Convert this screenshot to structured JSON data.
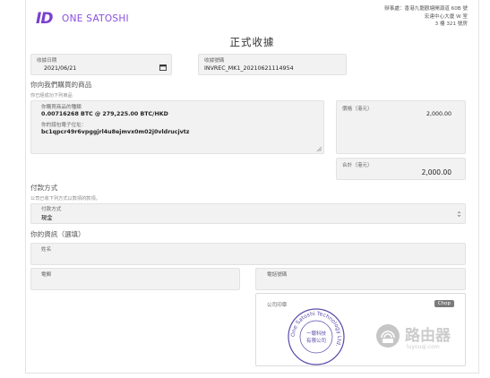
{
  "header": {
    "logo_mark": "ID",
    "logo_text": "ONE SATOSHI",
    "address_lines": [
      "辦事處：香港九龍觀塘開源道 60B 號",
      "宏達中心大廈 W 室",
      "3 樓 321 號房"
    ]
  },
  "title": "正式收據",
  "receipt_date": {
    "label": "收據日期",
    "value": "2021/06/21"
  },
  "receipt_number": {
    "label": "收據號碼",
    "value": "INVREC_MK1_20210621114954"
  },
  "purchase": {
    "section_title": "你向我們購買的商品",
    "hint": "你已經成功下列商品",
    "item_label": "你購買商品的種類",
    "item_value": "0.00716268 BTC @ 279,225.00 BTC/HKD",
    "wallet_label": "你的錢包電子位址：",
    "wallet_value": "bc1qpcr49r6vpggjrl4u8ejmvx0m02j0vldrucjvtz",
    "amount_label": "價格（港元）",
    "amount_value": "2,000.00",
    "total_label": "合計（港元）",
    "total_value": "2,000.00"
  },
  "payment": {
    "section_title": "付款方式",
    "hint": "公司已收下列方式以款項的款項。",
    "method_label": "付款方式",
    "method_value": "現金"
  },
  "customer": {
    "section_title": "你的資訊（選填）",
    "name_label": "姓名",
    "phone_label": "電郵",
    "phone2_label": "電話號碼",
    "chop_label": "公司印章",
    "chop_button": "Chop"
  },
  "stamp": {
    "ring_text": "One Satoshi Technology Ltd.",
    "center_line1": "一聰科技",
    "center_line2": "有限公司"
  },
  "watermark": {
    "text": "路由器",
    "sub": "luyouqi.com"
  },
  "colors": {
    "brand": "#7b3fd1",
    "stamp": "#5a4aa8"
  }
}
